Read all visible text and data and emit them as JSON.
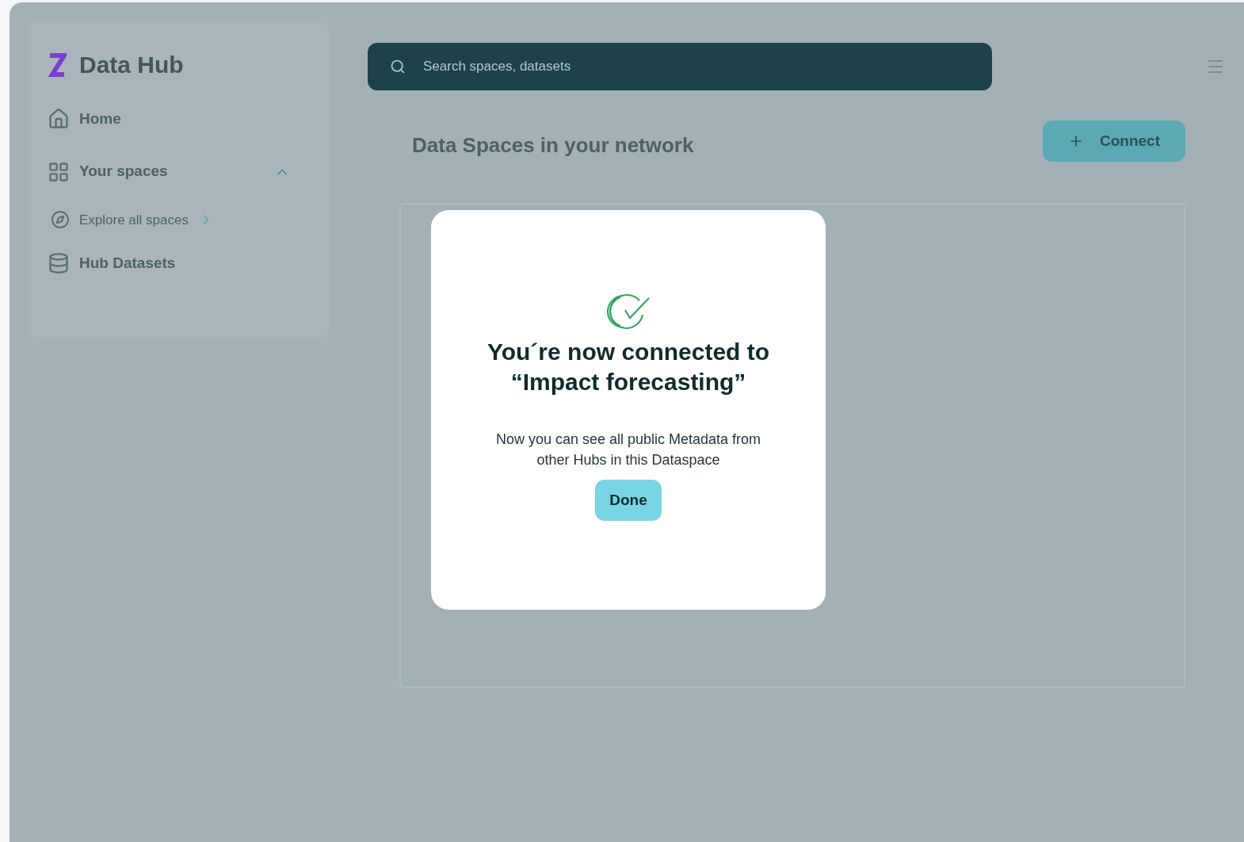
{
  "sidebar": {
    "brand": "Data Hub",
    "items": [
      {
        "kind": "link",
        "label": "Home"
      },
      {
        "kind": "group",
        "label": "Your spaces",
        "expanded": true
      },
      {
        "kind": "sublink",
        "label": "Explore all spaces"
      },
      {
        "kind": "link",
        "label": "Hub Datasets"
      }
    ]
  },
  "search": {
    "placeholder": "Search spaces, datasets"
  },
  "page": {
    "title": "Data Spaces in your network",
    "connect_button": "Connect"
  },
  "dialog": {
    "title_lines": [
      "You´re now connected to",
      "“Impact forecasting”"
    ],
    "message_lines": [
      "Now you can see all public Metadata from",
      "other Hubs in this Dataspace"
    ],
    "button": "Done"
  }
}
